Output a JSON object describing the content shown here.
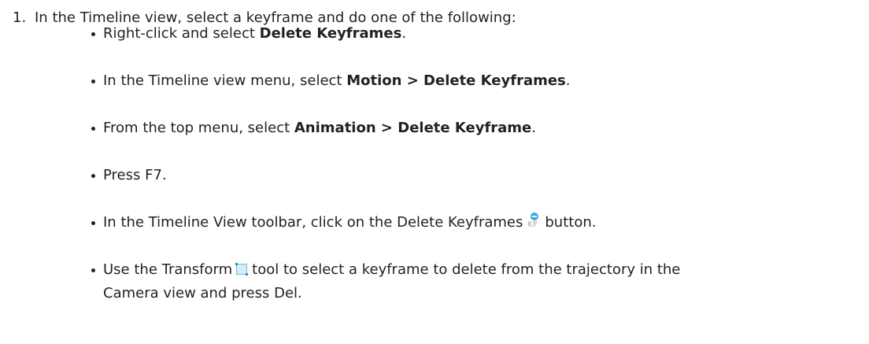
{
  "step": {
    "number": "1.",
    "text": "In the Timeline view, select a keyframe and do one of the following:"
  },
  "bullets": [
    {
      "before": "Right-click and select ",
      "bold": "Delete Keyframes",
      "after": "."
    },
    {
      "before": "In the Timeline view menu, select ",
      "bold": "Motion > Delete Keyframes",
      "after": "."
    },
    {
      "before": "From the top menu, select ",
      "bold": "Animation > Delete Keyframe",
      "after": "."
    },
    {
      "text": "Press F7."
    },
    {
      "before": "In the Timeline View toolbar, click on the Delete Keyframes",
      "icon_label": "KF",
      "icon": "delete-keyframes-icon",
      "after": "button."
    },
    {
      "before": "Use the Transform",
      "icon": "transform-tool-icon",
      "after": "tool to select a keyframe to delete from the trajectory in the",
      "line2": "Camera view and press Del."
    }
  ],
  "colors": {
    "text": "#222222",
    "icon_blue": "#38a8e0",
    "icon_gray": "#a0a0a0"
  }
}
